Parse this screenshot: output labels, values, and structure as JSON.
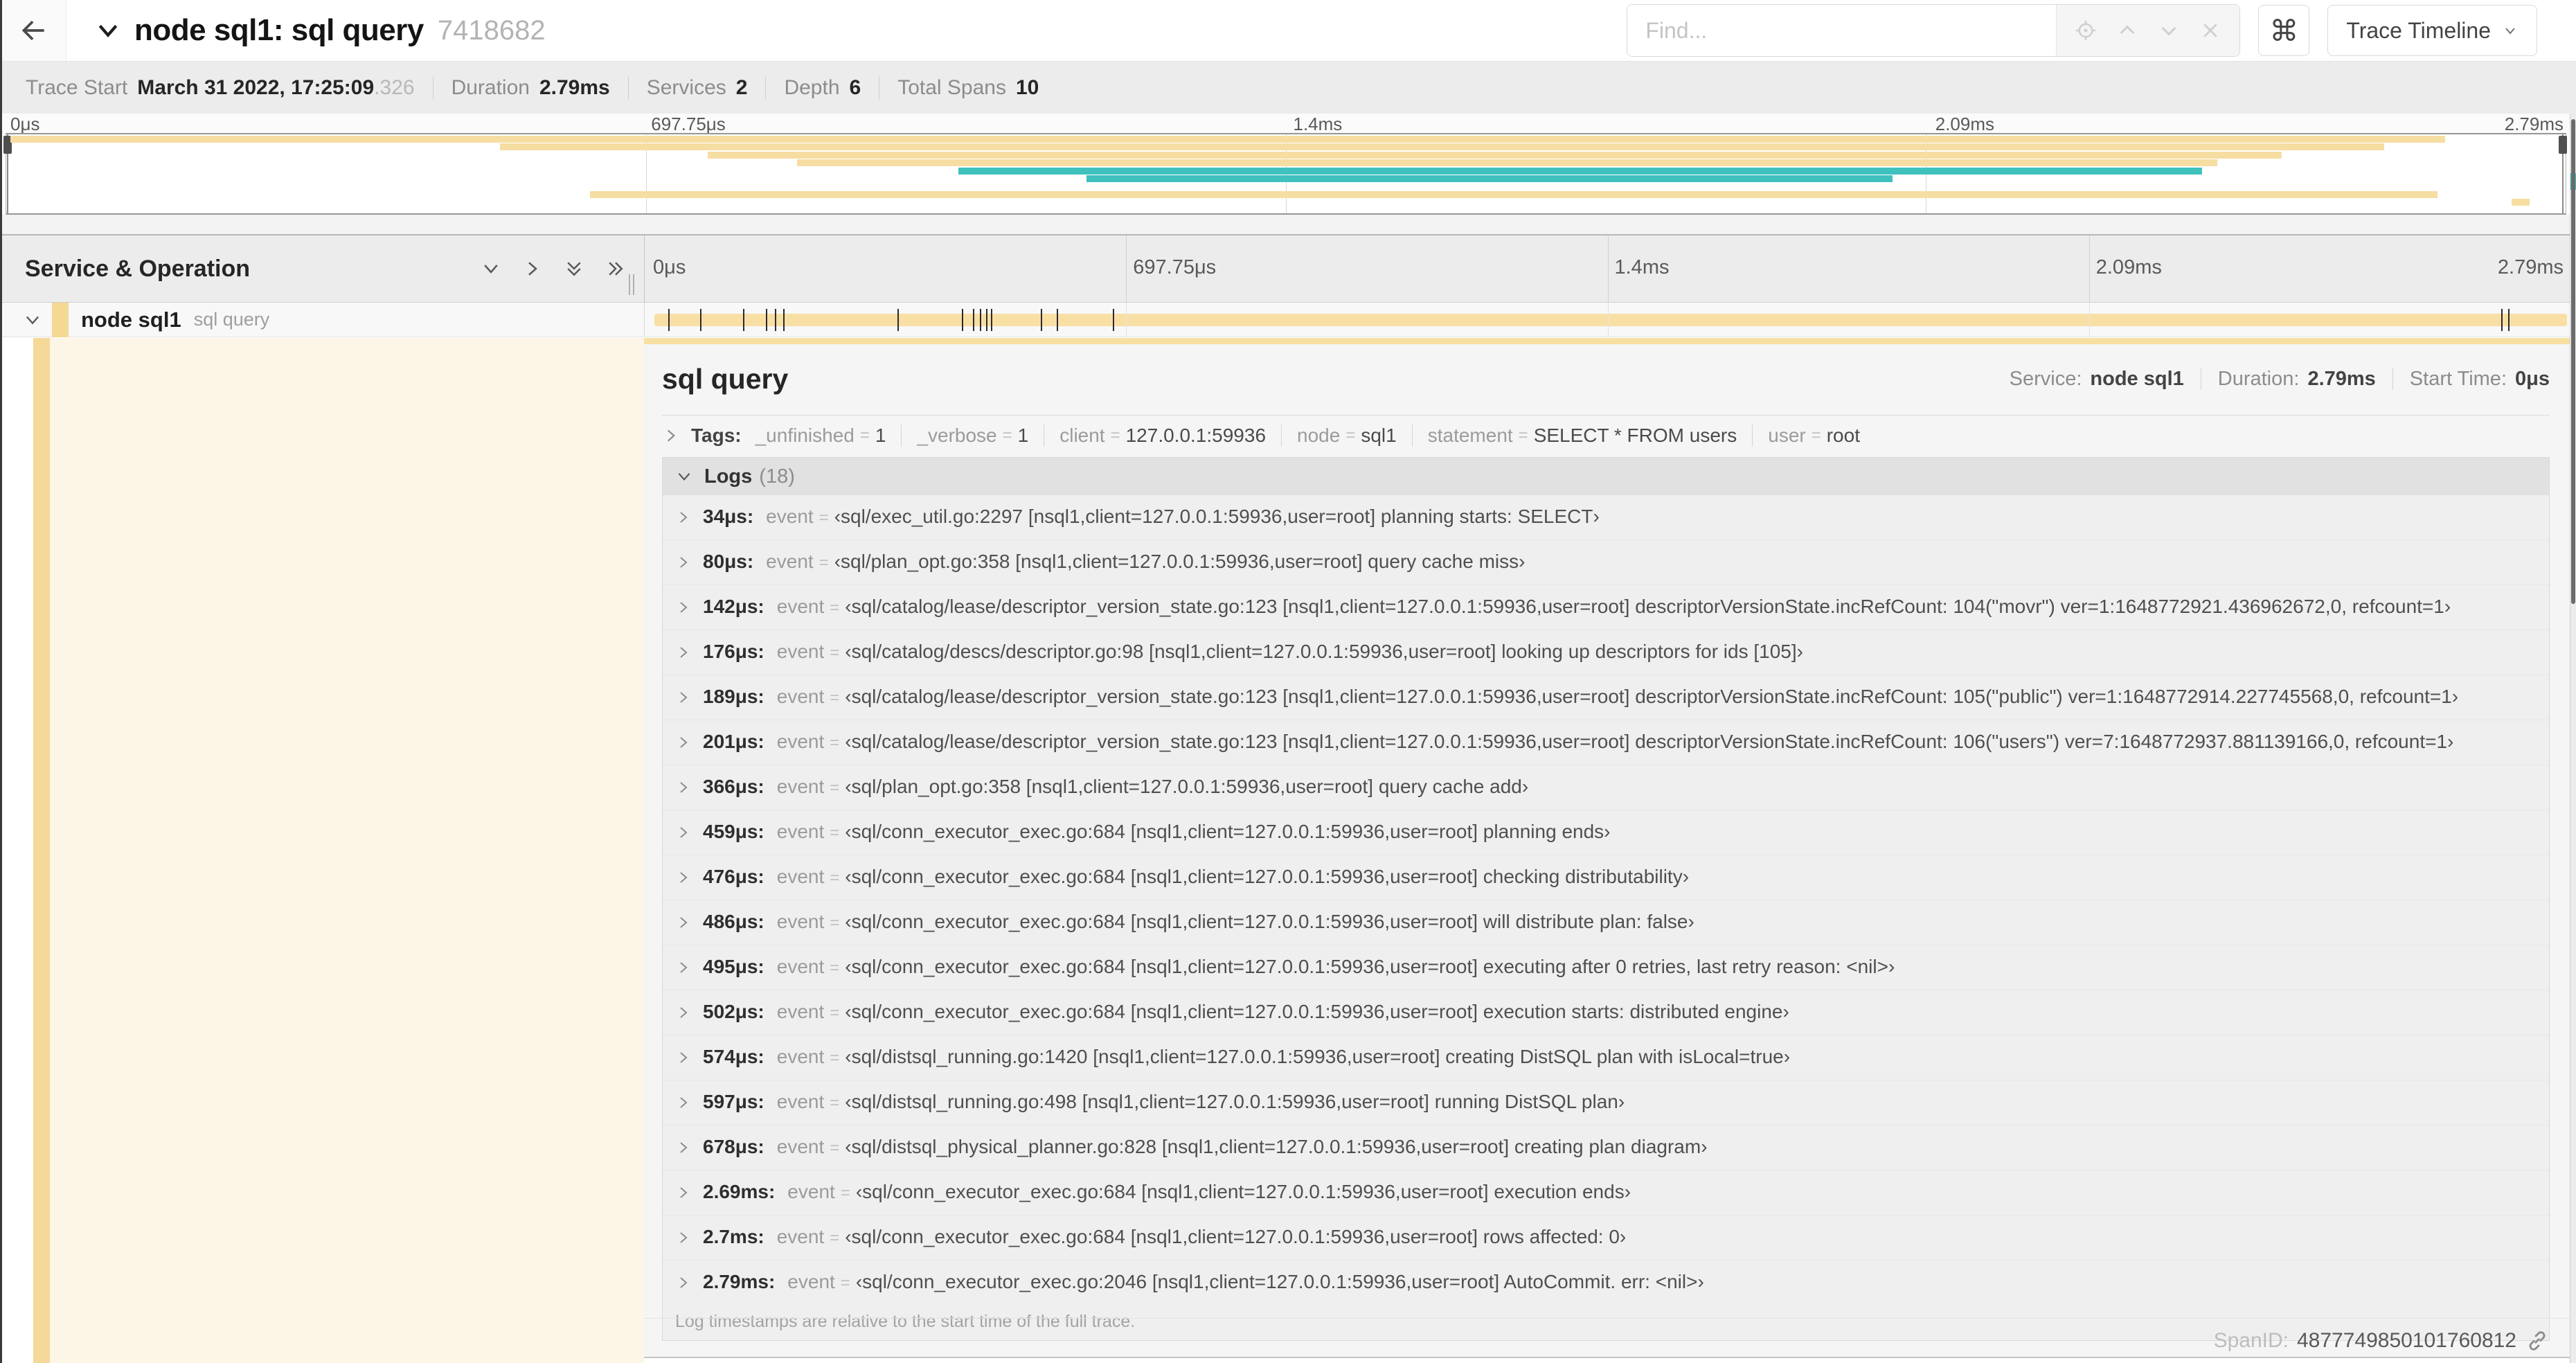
{
  "header": {
    "title": "node sql1: sql query",
    "trace_id_short": "7418682",
    "find_placeholder": "Find...",
    "keyboard_shortcut": "⌘",
    "view_selector_label": "Trace Timeline"
  },
  "trace_info": {
    "items": [
      {
        "label": "Trace Start",
        "value": "March 31 2022, 17:25:09",
        "suffix": ".326"
      },
      {
        "label": "Duration",
        "value": "2.79ms"
      },
      {
        "label": "Services",
        "value": "2"
      },
      {
        "label": "Depth",
        "value": "6"
      },
      {
        "label": "Total Spans",
        "value": "10"
      }
    ]
  },
  "timeline": {
    "column_header": "Service & Operation",
    "tick_labels": [
      "0μs",
      "697.75μs",
      "1.4ms",
      "2.09ms",
      "2.79ms"
    ],
    "total_us": 2790,
    "log_marker_positions_us": [
      34,
      80,
      142,
      176,
      189,
      201,
      366,
      459,
      476,
      486,
      495,
      502,
      574,
      597,
      678,
      2690,
      2700
    ]
  },
  "minimap": {
    "bars": [
      {
        "row": 0,
        "start": 0.15,
        "end": 95.3,
        "color": "tan"
      },
      {
        "row": 1,
        "start": 19.3,
        "end": 92.9,
        "color": "tan"
      },
      {
        "row": 2,
        "start": 27.4,
        "end": 88.9,
        "color": "tan"
      },
      {
        "row": 3,
        "start": 30.9,
        "end": 86.4,
        "color": "tan"
      },
      {
        "row": 4,
        "start": 37.2,
        "end": 85.8,
        "color": "teal"
      },
      {
        "row": 5,
        "start": 42.2,
        "end": 73.7,
        "color": "teal"
      },
      {
        "row": 7,
        "start": 22.8,
        "end": 95.0,
        "color": "tan"
      },
      {
        "row": 8,
        "start": 97.9,
        "end": 98.6,
        "color": "tan"
      }
    ]
  },
  "span_row": {
    "service": "node sql1",
    "operation": "sql query"
  },
  "detail": {
    "title": "sql query",
    "meta": [
      {
        "label": "Service:",
        "value": "node sql1"
      },
      {
        "label": "Duration:",
        "value": "2.79ms"
      },
      {
        "label": "Start Time:",
        "value": "0μs"
      }
    ],
    "tags": {
      "label": "Tags:",
      "items": [
        {
          "key": "_unfinished",
          "value": "1"
        },
        {
          "key": "_verbose",
          "value": "1"
        },
        {
          "key": "client",
          "value": "127.0.0.1:59936"
        },
        {
          "key": "node",
          "value": "sql1"
        },
        {
          "key": "statement",
          "value": "SELECT * FROM users"
        },
        {
          "key": "user",
          "value": "root"
        }
      ]
    },
    "logs": {
      "label": "Logs",
      "count": "(18)",
      "rows": [
        {
          "time": "34μs:",
          "key": "event",
          "value": "‹sql/exec_util.go:2297 [nsql1,client=127.0.0.1:59936,user=root] planning starts: SELECT›"
        },
        {
          "time": "80μs:",
          "key": "event",
          "value": "‹sql/plan_opt.go:358 [nsql1,client=127.0.0.1:59936,user=root] query cache miss›"
        },
        {
          "time": "142μs:",
          "key": "event",
          "value": "‹sql/catalog/lease/descriptor_version_state.go:123 [nsql1,client=127.0.0.1:59936,user=root] descriptorVersionState.incRefCount: 104(\"movr\") ver=1:1648772921.436962672,0, refcount=1›"
        },
        {
          "time": "176μs:",
          "key": "event",
          "value": "‹sql/catalog/descs/descriptor.go:98 [nsql1,client=127.0.0.1:59936,user=root] looking up descriptors for ids [105]›"
        },
        {
          "time": "189μs:",
          "key": "event",
          "value": "‹sql/catalog/lease/descriptor_version_state.go:123 [nsql1,client=127.0.0.1:59936,user=root] descriptorVersionState.incRefCount: 105(\"public\") ver=1:1648772914.227745568,0, refcount=1›"
        },
        {
          "time": "201μs:",
          "key": "event",
          "value": "‹sql/catalog/lease/descriptor_version_state.go:123 [nsql1,client=127.0.0.1:59936,user=root] descriptorVersionState.incRefCount: 106(\"users\") ver=7:1648772937.881139166,0, refcount=1›"
        },
        {
          "time": "366μs:",
          "key": "event",
          "value": "‹sql/plan_opt.go:358 [nsql1,client=127.0.0.1:59936,user=root] query cache add›"
        },
        {
          "time": "459μs:",
          "key": "event",
          "value": "‹sql/conn_executor_exec.go:684 [nsql1,client=127.0.0.1:59936,user=root] planning ends›"
        },
        {
          "time": "476μs:",
          "key": "event",
          "value": "‹sql/conn_executor_exec.go:684 [nsql1,client=127.0.0.1:59936,user=root] checking distributability›"
        },
        {
          "time": "486μs:",
          "key": "event",
          "value": "‹sql/conn_executor_exec.go:684 [nsql1,client=127.0.0.1:59936,user=root] will distribute plan: false›"
        },
        {
          "time": "495μs:",
          "key": "event",
          "value": "‹sql/conn_executor_exec.go:684 [nsql1,client=127.0.0.1:59936,user=root] executing after 0 retries, last retry reason: <nil>›"
        },
        {
          "time": "502μs:",
          "key": "event",
          "value": "‹sql/conn_executor_exec.go:684 [nsql1,client=127.0.0.1:59936,user=root] execution starts: distributed engine›"
        },
        {
          "time": "574μs:",
          "key": "event",
          "value": "‹sql/distsql_running.go:1420 [nsql1,client=127.0.0.1:59936,user=root] creating DistSQL plan with isLocal=true›"
        },
        {
          "time": "597μs:",
          "key": "event",
          "value": "‹sql/distsql_running.go:498 [nsql1,client=127.0.0.1:59936,user=root] running DistSQL plan›"
        },
        {
          "time": "678μs:",
          "key": "event",
          "value": "‹sql/distsql_physical_planner.go:828 [nsql1,client=127.0.0.1:59936,user=root] creating plan diagram›"
        },
        {
          "time": "2.69ms:",
          "key": "event",
          "value": "‹sql/conn_executor_exec.go:684 [nsql1,client=127.0.0.1:59936,user=root] execution ends›"
        },
        {
          "time": "2.7ms:",
          "key": "event",
          "value": "‹sql/conn_executor_exec.go:684 [nsql1,client=127.0.0.1:59936,user=root] rows affected: 0›"
        },
        {
          "time": "2.79ms:",
          "key": "event",
          "value": "‹sql/conn_executor_exec.go:2046 [nsql1,client=127.0.0.1:59936,user=root] AutoCommit. err: <nil>›"
        }
      ]
    },
    "footnote": "Log timestamps are relative to the start time of the full trace.",
    "span_id_label": "SpanID:",
    "span_id": "4877749850101760812"
  },
  "colors": {
    "span_tan": "#f8dfa3",
    "span_teal": "#40c1be"
  }
}
